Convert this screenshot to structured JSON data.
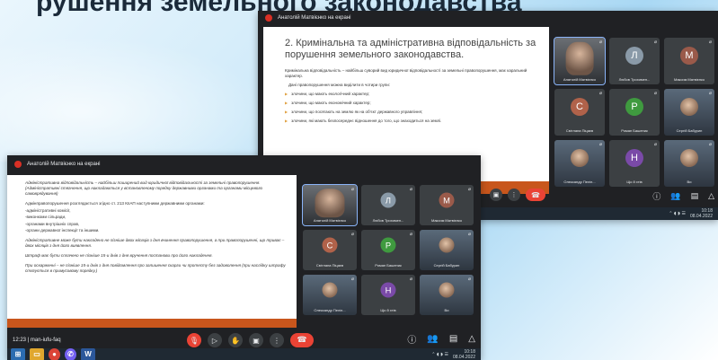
{
  "slide": {
    "title": "рушення земельного законодавства"
  },
  "back": {
    "header_name": "Анатолій Матвієнко на екрані",
    "present_title": "2. Кримінальна та адміністративна відповідальність за порушення земельного законодавства.",
    "para1": "Кримінальна відповідальність – найбільш суворий вид юридичної відповідальності за земельні правопорушення, має каральний характер.",
    "para2": "Дані правопорушення можна виділити в чотири групи:",
    "items": [
      "злочини, що мають екологічний характер;",
      "злочини, що мають економічний характер;",
      "злочини, що посягають на землю як на об'єкт державного управління;",
      "злочини, які мають безпосереднє відношення до того, що знаходиться на землі."
    ],
    "tiles": [
      {
        "name": "Анатолій Матвієнко",
        "initial": "",
        "color": "",
        "kind": "video"
      },
      {
        "name": "Любов Трохимен...",
        "initial": "Л",
        "color": "#8a9aa8"
      },
      {
        "name": "Максим Матвієнко",
        "initial": "М",
        "color": "#9a5a4a"
      },
      {
        "name": "Світлана Піцаєв",
        "initial": "С",
        "color": "#b0624a"
      },
      {
        "name": "Роман Башеник",
        "initial": "Р",
        "color": "#3f9a3f"
      },
      {
        "name": "Сергій Бабурин",
        "initial": "",
        "color": "",
        "kind": "photo"
      },
      {
        "name": "Олександр Пеліп...",
        "initial": "",
        "color": "",
        "kind": "photo"
      },
      {
        "name": "Що й хтів",
        "initial": "Н",
        "color": "#7a4aa8"
      },
      {
        "name": "Ви",
        "initial": "",
        "color": "",
        "kind": "photo"
      }
    ]
  },
  "front": {
    "header_name": "Анатолій Матвієнко на екрані",
    "lines": [
      "Адміністративна відповідальність – найбільш поширений вид юридичної відповідальності за земельні правопорушення. (Адміністративні стягнення, що накладаються у встановленому порядку державними органами та органами місцевого самоврядування)",
      "Адмінправопорушення розглядається згідно ст. 213 КпАП наступними державними органами:",
      "-адміністративні комісії,",
      "-виконкоми сільради,",
      "-органами внутрішніх справ,",
      "-органи державної інспекції та іншими.",
      "Адміністративне може бути накладено не пізніше двох місяців з дня вчинення правопорушення, а при правопорушенні, що триває – двох місяців з дня його виявлення.",
      "Штраф має бути сплачено не пізніше 15-и днів з дня вручення постанови про його накладення.",
      "При оскарженні – не пізніше 15-и днів з дня повідомлення про залишення скарги чи протесту без задоволення (при наслідку штрафу стягується в примусовому порядку.)"
    ],
    "tiles": [
      {
        "name": "Анатолій Матвієнко",
        "initial": "",
        "color": "",
        "kind": "video"
      },
      {
        "name": "Любов Трохимен...",
        "initial": "Л",
        "color": "#8a9aa8"
      },
      {
        "name": "Максим Матвієнко",
        "initial": "М",
        "color": "#9a5a4a"
      },
      {
        "name": "Світлана Піцаєв",
        "initial": "С",
        "color": "#b0624a"
      },
      {
        "name": "Роман Башеник",
        "initial": "Р",
        "color": "#3f9a3f"
      },
      {
        "name": "Сергій Бабурин",
        "initial": "",
        "color": "",
        "kind": "photo"
      },
      {
        "name": "Олександр Пеліп...",
        "initial": "",
        "color": "",
        "kind": "photo"
      },
      {
        "name": "Що й хтів",
        "initial": "Н",
        "color": "#7a4aa8"
      },
      {
        "name": "Ви",
        "initial": "",
        "color": "",
        "kind": "photo"
      }
    ],
    "meeting_info": "12:23 | man-iufu-faq"
  },
  "icons": {
    "mic_off": "mic-off-icon",
    "camera": "camera-icon",
    "hand": "raise-hand-icon",
    "present": "present-icon",
    "more": "more-options-icon",
    "end": "end-call-icon",
    "info": "info-icon",
    "people": "people-icon",
    "chat": "chat-icon",
    "activities": "activities-icon"
  },
  "taskbar": {
    "time": "10:18",
    "date": "08.04.2022"
  },
  "colors": {
    "accent_bar": "#c8561c",
    "meet_bg": "#202124",
    "end_red": "#ea4335"
  }
}
